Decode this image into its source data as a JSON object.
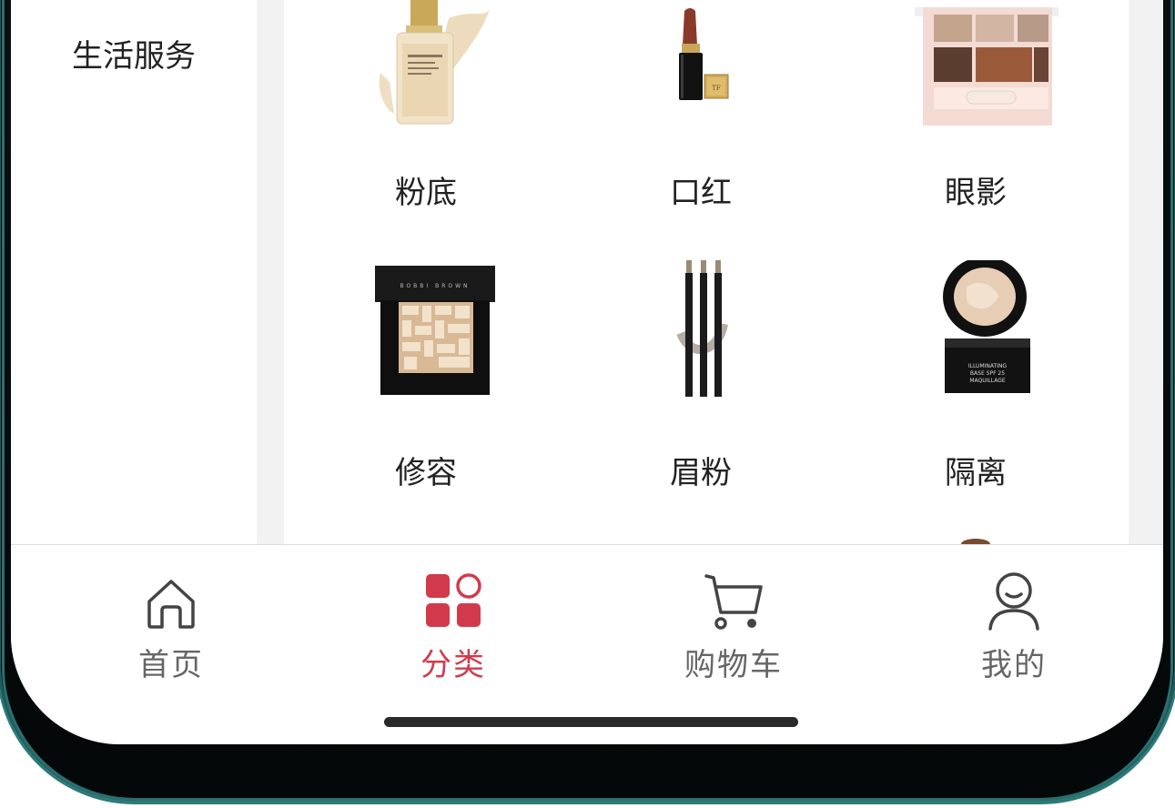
{
  "sidebar": {
    "items": [
      {
        "label": "生活服务"
      }
    ]
  },
  "grid": {
    "items": [
      {
        "label": "粉底",
        "icon": "foundation-bottle-icon"
      },
      {
        "label": "口红",
        "icon": "lipstick-icon"
      },
      {
        "label": "眼影",
        "icon": "eyeshadow-palette-icon"
      },
      {
        "label": "修容",
        "icon": "highlighter-compact-icon"
      },
      {
        "label": "眉粉",
        "icon": "brow-pencil-icon"
      },
      {
        "label": "隔离",
        "icon": "primer-jar-icon"
      }
    ]
  },
  "tabbar": {
    "tabs": [
      {
        "label": "首页",
        "icon": "home-icon"
      },
      {
        "label": "分类",
        "icon": "category-grid-icon",
        "active": true
      },
      {
        "label": "购物车",
        "icon": "cart-icon"
      },
      {
        "label": "我的",
        "icon": "user-icon"
      }
    ]
  },
  "colors": {
    "accent": "#d23a4c",
    "frame": "#2b6f6d",
    "tab_inactive": "#666666"
  }
}
